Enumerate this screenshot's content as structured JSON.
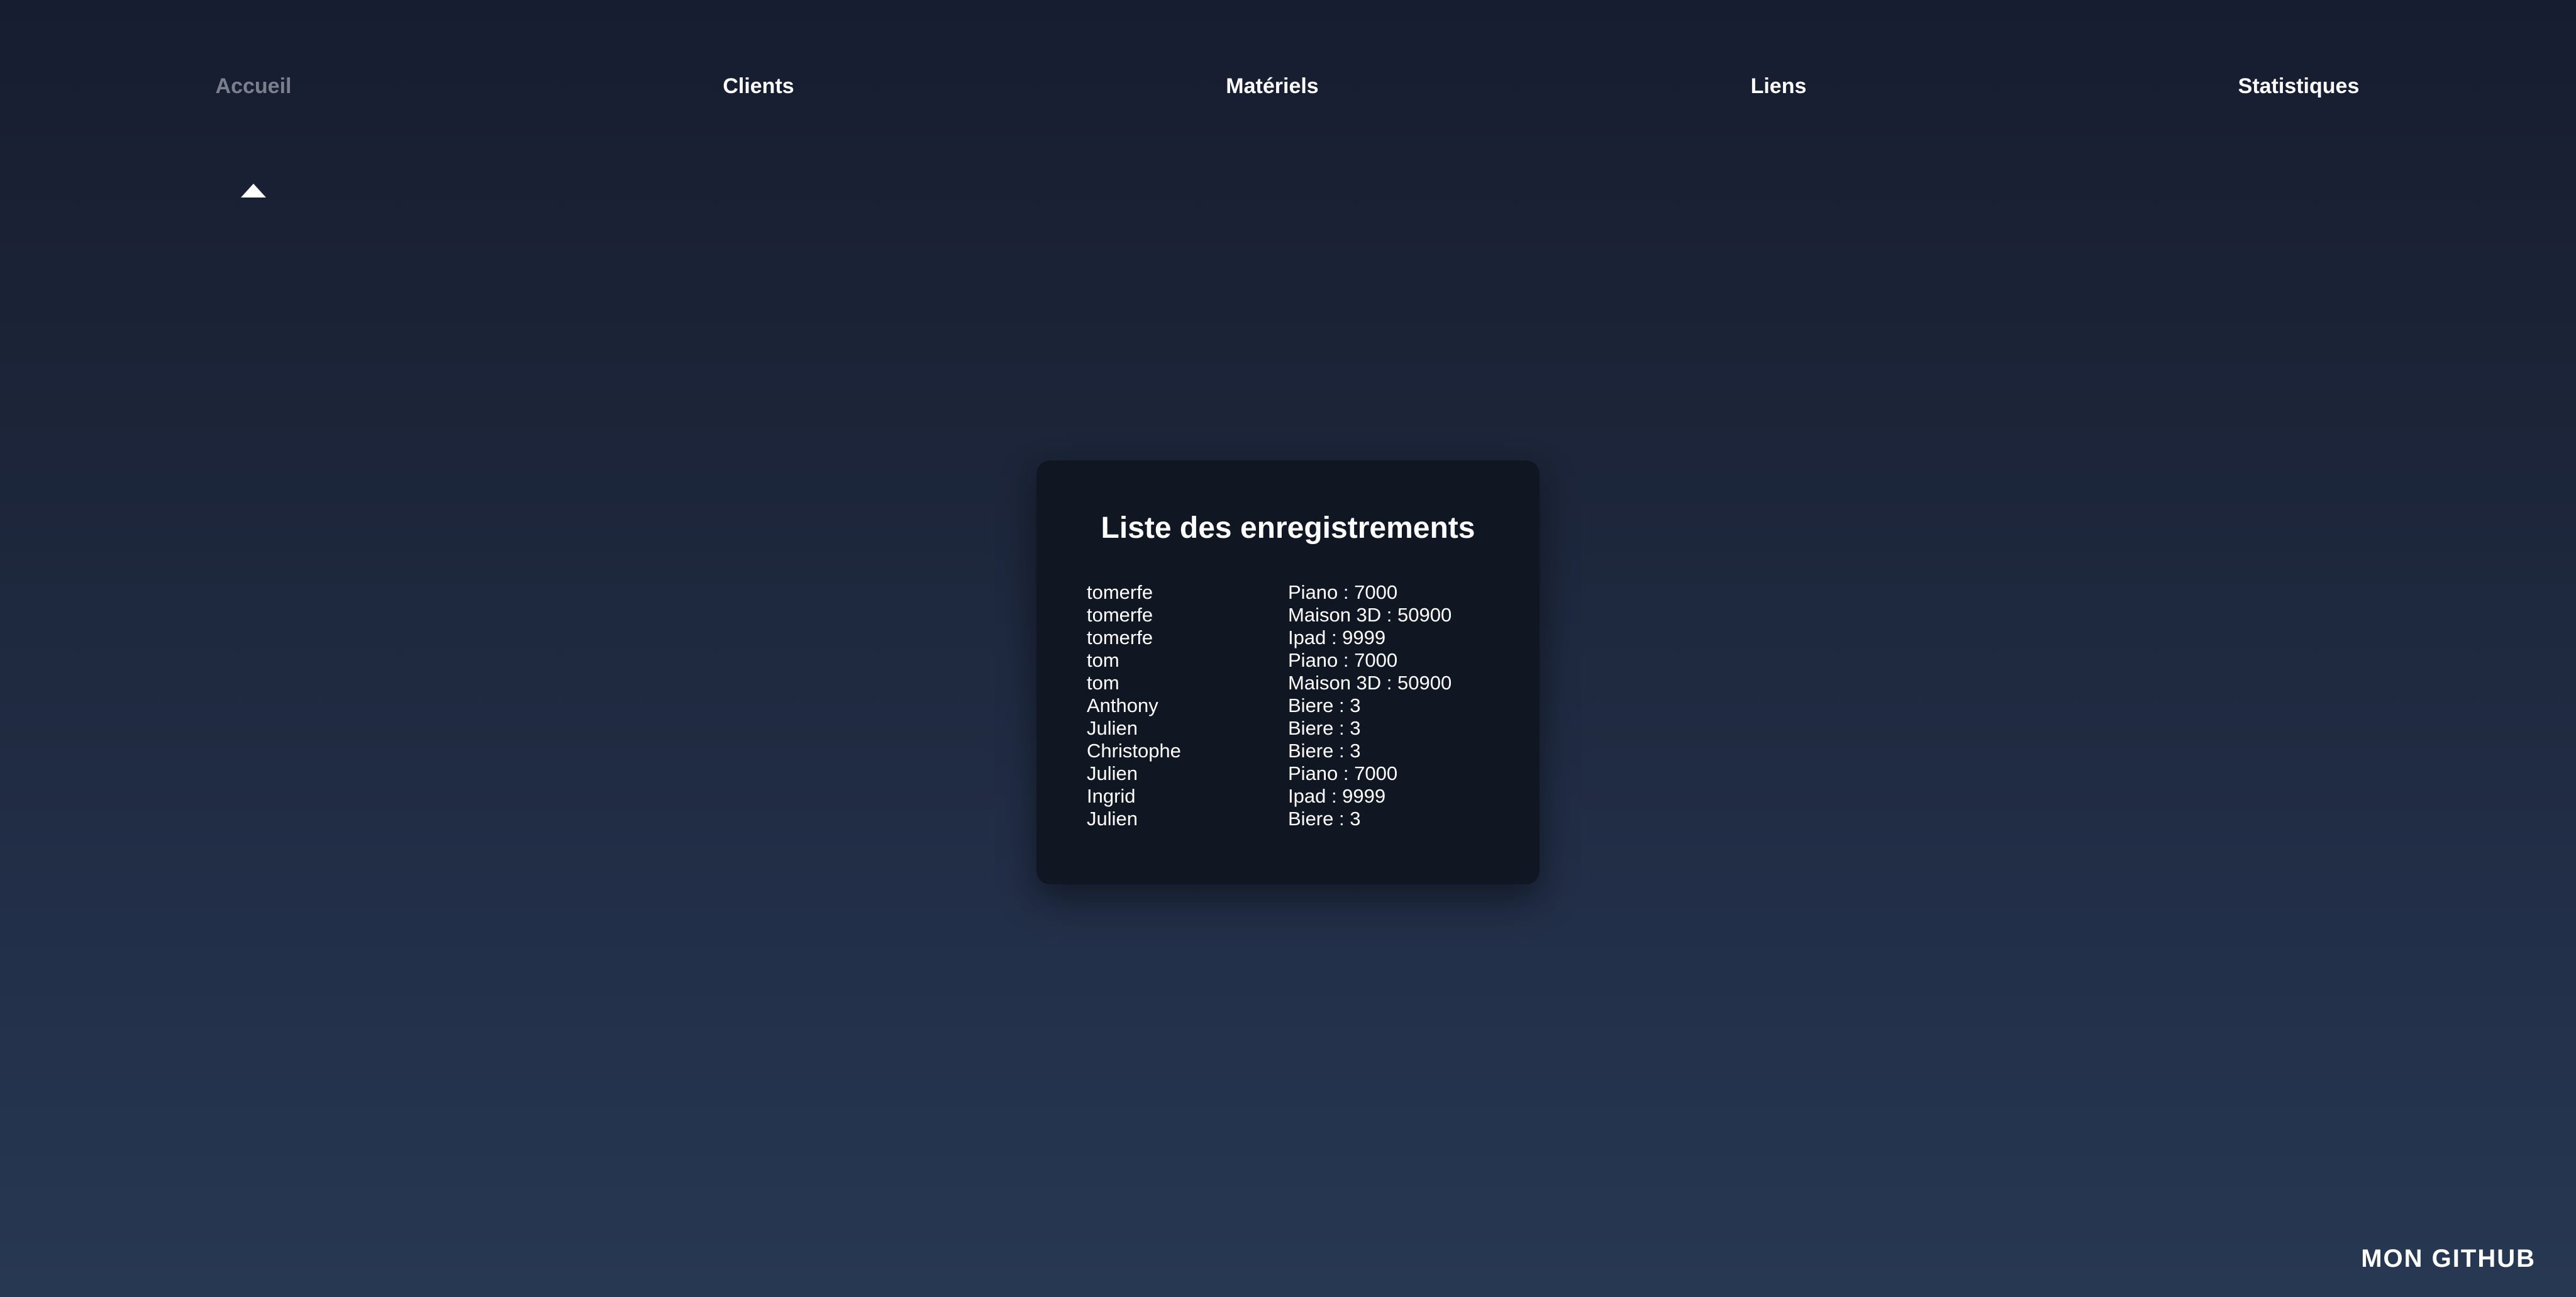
{
  "nav": {
    "items": [
      {
        "label": "Accueil",
        "active": true
      },
      {
        "label": "Clients",
        "active": false
      },
      {
        "label": "Matériels",
        "active": false
      },
      {
        "label": "Liens",
        "active": false
      },
      {
        "label": "Statistiques",
        "active": false
      }
    ]
  },
  "card": {
    "title": "Liste des enregistrements",
    "records": [
      {
        "client": "tomerfe",
        "item": "Piano : 7000"
      },
      {
        "client": "tomerfe",
        "item": "Maison 3D : 50900"
      },
      {
        "client": "tomerfe",
        "item": "Ipad : 9999"
      },
      {
        "client": "tom",
        "item": "Piano : 7000"
      },
      {
        "client": "tom",
        "item": "Maison 3D : 50900"
      },
      {
        "client": "Anthony",
        "item": "Biere : 3"
      },
      {
        "client": "Julien",
        "item": "Biere : 3"
      },
      {
        "client": "Christophe",
        "item": "Biere : 3"
      },
      {
        "client": "Julien",
        "item": "Piano : 7000"
      },
      {
        "client": "Ingrid",
        "item": "Ipad : 9999"
      },
      {
        "client": "Julien",
        "item": "Biere : 3"
      }
    ]
  },
  "footer": {
    "github_label": "MON GITHUB"
  },
  "colors": {
    "nav_active": "#7b808c",
    "card_background": "#111722",
    "text": "#ffffff"
  }
}
